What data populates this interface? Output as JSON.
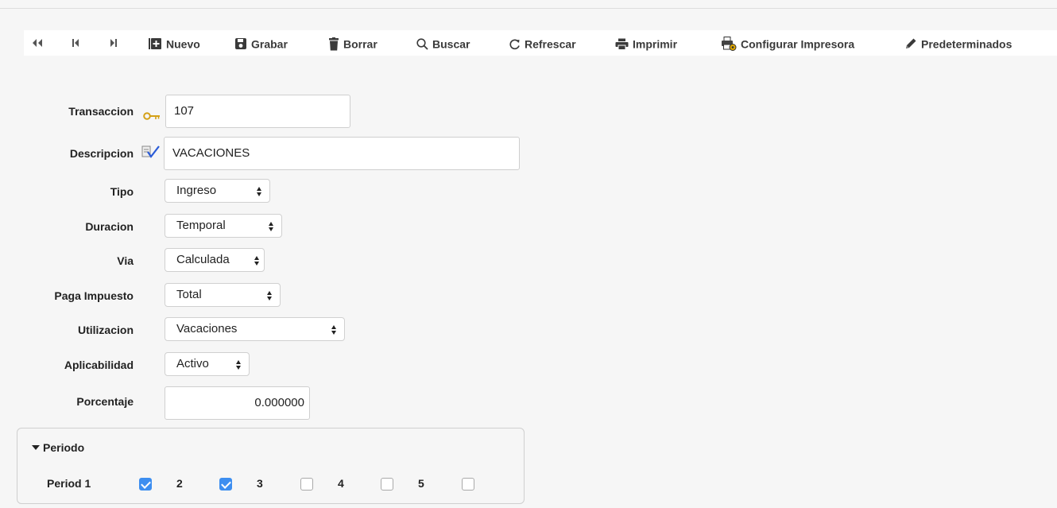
{
  "toolbar": {
    "first_icon": "double-left-arrow-icon",
    "prev_icon": "step-backward-icon",
    "next_icon": "step-forward-icon",
    "nuevo": "Nuevo",
    "grabar": "Grabar",
    "borrar": "Borrar",
    "buscar": "Buscar",
    "refrescar": "Refrescar",
    "imprimir": "Imprimir",
    "configurar": "Configurar Impresora",
    "predeterminados": "Predeterminados"
  },
  "form": {
    "transaccion_label": "Transaccion",
    "transaccion_value": "107",
    "descripcion_label": "Descripcion",
    "descripcion_value": "VACACIONES",
    "tipo_label": "Tipo",
    "tipo_value": "Ingreso",
    "duracion_label": "Duracion",
    "duracion_value": "Temporal",
    "via_label": "Via",
    "via_value": "Calculada",
    "paga_label": "Paga Impuesto",
    "paga_value": "Total",
    "utilizacion_label": "Utilizacion",
    "utilizacion_value": "Vacaciones",
    "aplicabilidad_label": "Aplicabilidad",
    "aplicabilidad_value": "Activo",
    "porcentaje_label": "Porcentaje",
    "porcentaje_value": "0.000000"
  },
  "periodo": {
    "legend": "Periodo",
    "items": [
      {
        "label": "Period 1",
        "checked": true
      },
      {
        "label": "2",
        "checked": true
      },
      {
        "label": "3",
        "checked": false
      },
      {
        "label": "4",
        "checked": false
      },
      {
        "label": "5",
        "checked": false
      }
    ]
  },
  "colors": {
    "accent": "#3d8ef0",
    "background": "#f6f6f6",
    "key_icon": "#d4a017"
  }
}
